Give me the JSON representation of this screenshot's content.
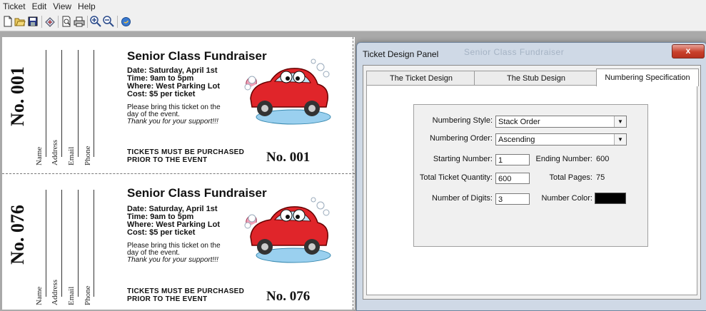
{
  "menu": [
    "Ticket",
    "Edit",
    "View",
    "Help"
  ],
  "toolbar": {
    "icons": [
      "new-icon",
      "open-icon",
      "save-icon",
      "design-icon",
      "print-preview-icon",
      "print-icon",
      "zoom-in-icon",
      "zoom-out-icon",
      "help-icon"
    ]
  },
  "tickets": [
    {
      "stub_number": "No. 001",
      "stub_fields": [
        "Name",
        "Address",
        "Email",
        "Phone"
      ],
      "title": "Senior Class Fundraiser",
      "details": [
        "Date: Saturday, April 1st",
        "Time: 9am to 5pm",
        "Where: West Parking Lot",
        "Cost: $5 per ticket"
      ],
      "note": [
        "Please bring this ticket on the",
        "day of the event."
      ],
      "thanks": "Thank you for your support!!!",
      "purchase": [
        "TICKETS MUST BE PURCHASED",
        "PRIOR TO THE EVENT"
      ],
      "number": "No. 001"
    },
    {
      "stub_number": "No. 076",
      "stub_fields": [
        "Name",
        "Address",
        "Email",
        "Phone"
      ],
      "title": "Senior Class Fundraiser",
      "details": [
        "Date: Saturday, April 1st",
        "Time: 9am to 5pm",
        "Where: West Parking Lot",
        "Cost: $5 per ticket"
      ],
      "note": [
        "Please bring this ticket on the",
        "day of the event."
      ],
      "thanks": "Thank you for your support!!!",
      "purchase": [
        "TICKETS MUST BE PURCHASED",
        "PRIOR TO THE EVENT"
      ],
      "number": "No. 076"
    }
  ],
  "panel": {
    "title": "Ticket Design Panel",
    "ghost_title": "Senior Class Fundraiser",
    "close_label": "x",
    "tabs": [
      "The Ticket Design",
      "The Stub Design",
      "Numbering Specification"
    ],
    "active_tab": "Numbering Specification",
    "numbering_style": {
      "label": "Numbering Style:",
      "value": "Stack Order"
    },
    "numbering_order": {
      "label": "Numbering Order:",
      "value": "Ascending"
    },
    "starting_number": {
      "label": "Starting Number:",
      "value": "1"
    },
    "ending_number": {
      "label": "Ending Number:",
      "value": "600"
    },
    "total_quantity": {
      "label": "Total Ticket Quantity:",
      "value": "600"
    },
    "total_pages": {
      "label": "Total Pages:",
      "value": "75"
    },
    "digits": {
      "label": "Number of Digits:",
      "value": "3"
    },
    "number_color": {
      "label": "Number Color:",
      "value": "#000000"
    }
  }
}
